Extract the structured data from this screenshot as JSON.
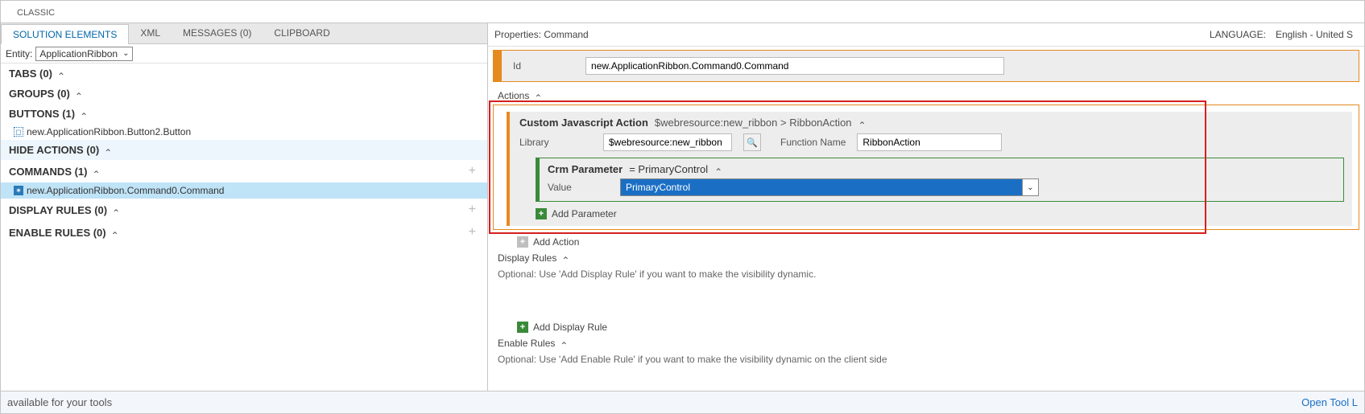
{
  "topbar": {
    "classic": "CLASSIC"
  },
  "tabs": {
    "solution_elements": "SOLUTION ELEMENTS",
    "xml": "XML",
    "messages": "MESSAGES (0)",
    "clipboard": "CLIPBOARD"
  },
  "entity": {
    "label": "Entity:",
    "value": "ApplicationRibbon"
  },
  "sidebar": {
    "tabs": "TABS (0)",
    "groups": "GROUPS (0)",
    "buttons": "BUTTONS (1)",
    "button_item": "new.ApplicationRibbon.Button2.Button",
    "hide_actions": "HIDE ACTIONS (0)",
    "commands": "COMMANDS (1)",
    "command_item": "new.ApplicationRibbon.Command0.Command",
    "display_rules": "DISPLAY RULES (0)",
    "enable_rules": "ENABLE RULES (0)"
  },
  "properties": {
    "header": "Properties: Command",
    "language_label": "LANGUAGE:",
    "language_value": "English - United S",
    "id_label": "Id",
    "id_value": "new.ApplicationRibbon.Command0.Command",
    "actions_label": "Actions",
    "js_action_title": "Custom Javascript Action",
    "js_action_path": "$webresource:new_ribbon > RibbonAction",
    "library_label": "Library",
    "library_value": "$webresource:new_ribbon",
    "function_label": "Function Name",
    "function_value": "RibbonAction",
    "crm_param_title": "Crm Parameter",
    "crm_param_eq": "= PrimaryControl",
    "value_label": "Value",
    "value_selected": "PrimaryControl",
    "add_parameter": "Add Parameter",
    "add_action": "Add Action",
    "display_rules_label": "Display Rules",
    "display_rules_hint": "Optional: Use 'Add Display Rule' if you want to make the visibility dynamic.",
    "add_display_rule": "Add Display Rule",
    "enable_rules_label": "Enable Rules",
    "enable_rules_hint": "Optional: Use 'Add Enable Rule' if you want to make the visibility dynamic on the client side"
  },
  "footer": {
    "left": "available for your tools",
    "right": "Open Tool L"
  }
}
